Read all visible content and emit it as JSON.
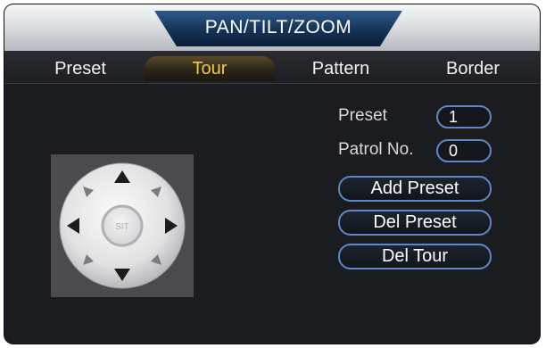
{
  "window": {
    "title": "PAN/TILT/ZOOM"
  },
  "tabs": [
    {
      "label": "Preset",
      "active": false
    },
    {
      "label": "Tour",
      "active": true
    },
    {
      "label": "Pattern",
      "active": false
    },
    {
      "label": "Border",
      "active": false
    }
  ],
  "ptz_pad": {
    "center_label": "SIT",
    "arrows": [
      "up-icon",
      "down-icon",
      "left-icon",
      "right-icon",
      "up-left-icon",
      "up-right-icon",
      "down-left-icon",
      "down-right-icon"
    ]
  },
  "form": {
    "preset_label": "Preset",
    "preset_value": "1",
    "patrol_label": "Patrol No.",
    "patrol_value": "0"
  },
  "buttons": {
    "add_preset": "Add Preset",
    "del_preset": "Del Preset",
    "del_tour": "Del Tour"
  },
  "colors": {
    "accent_tab_text": "#f3c84a",
    "field_border": "#5f86c6",
    "panel_background": "#1b1c20"
  }
}
